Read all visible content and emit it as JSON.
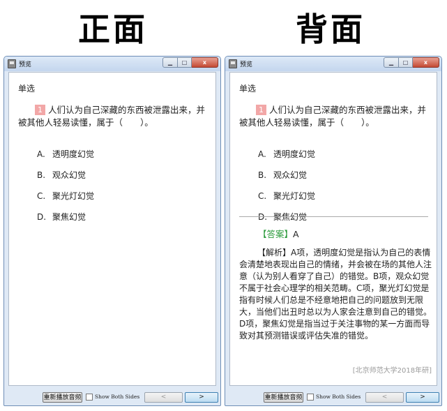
{
  "headings": {
    "front": "正面",
    "back": "背面"
  },
  "window": {
    "title": "预览",
    "min_icon": "minimize-icon",
    "max_icon": "maximize-icon",
    "close_label": "x"
  },
  "question": {
    "type": "单选",
    "number": "1",
    "stem": "人们认为自己深藏的东西被泄露出来，并被其他人轻易读懂，属于（　　）。",
    "options": [
      {
        "letter": "A.",
        "text": "透明度幻觉"
      },
      {
        "letter": "B.",
        "text": "观众幻觉"
      },
      {
        "letter": "C.",
        "text": "聚光灯幻觉"
      },
      {
        "letter": "D.",
        "text": "聚焦幻觉"
      }
    ]
  },
  "answer": {
    "tag": "【答案】",
    "value": "A",
    "explanation": "【解析】A项，透明度幻觉是指认为自己的表情会清楚地表现出自己的情绪，并会被在场的其他人注意（认为别人看穿了自己）的错觉。B项，观众幻觉不属于社会心理学的相关范畴。C项，聚光灯幻觉是指有时候人们总是不经意地把自己的问题放到无限大，当他们出丑时总以为人家会注意到自己的错觉。D项，聚焦幻觉是指当过于关注事物的某一方面而导致对其预测错误或评估失准的错觉。",
    "source": "[北京师范大学2018年研]"
  },
  "bottombar": {
    "replay_label": "重新播放音频",
    "show_both_label": "Show Both Sides",
    "show_both_checked": false,
    "prev_label": "<",
    "next_label": ">"
  }
}
